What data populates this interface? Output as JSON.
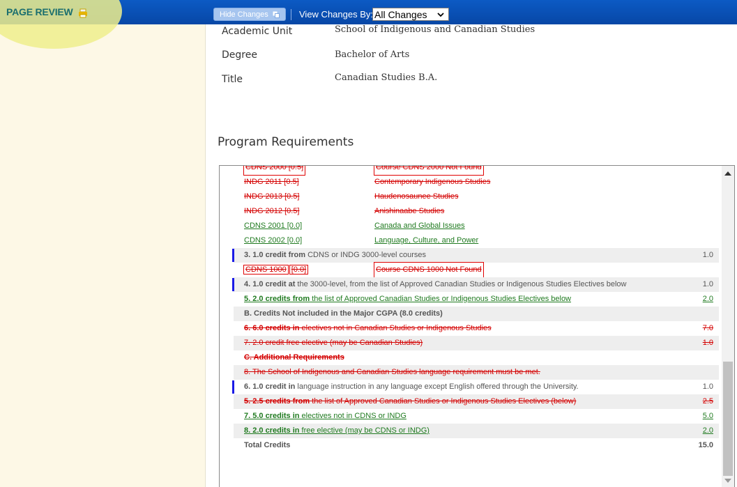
{
  "toolbar": {
    "brand_label": "PAGE REVIEW",
    "hide_changes_label": "Hide Changes",
    "view_changes_label": "View Changes By:",
    "view_changes_value": "All Changes",
    "colors": {
      "bar": "#0747a6",
      "highlight": "#eeee8c",
      "sidebar": "#fdf8e6"
    },
    "icons": [
      "printer-icon",
      "copy-icon",
      "chevron-down-icon"
    ]
  },
  "program": {
    "academic_unit_label": "Academic Unit",
    "academic_unit_value": "School of Indigenous and Canadian Studies",
    "degree_label": "Degree",
    "degree_value": "Bachelor of Arts",
    "title_label": "Title",
    "title_value": "Canadian Studies B.A."
  },
  "requirements": {
    "heading": "Program Requirements",
    "colors": {
      "deleted": "#d40000",
      "inserted": "#1f7a1f",
      "marker": "#1a1ae6",
      "shade": "#eeeeee"
    },
    "r0": {
      "c1": "CDNS 2000 [0.5]",
      "c2": "Course CDNS 2000 Not Found"
    },
    "r1": {
      "c1": "INDG 2011 [0.5]",
      "c2": "Contemporary Indigenous Studies"
    },
    "r2": {
      "c1": "INDG 2013 [0.5]",
      "c2": "Haudenosaunee Studies"
    },
    "r3": {
      "c1": "INDG 2012 [0.5]",
      "c2": "Anishinaabe Studies"
    },
    "r4": {
      "c1": "CDNS 2001 [0.0]",
      "c2": "Canada and Global Issues"
    },
    "r5": {
      "c1": "CDNS 2002 [0.0]",
      "c2": "Language, Culture, and Power"
    },
    "r6": {
      "bold": "3. 1.0 credit from",
      "rest": " CDNS or INDG 3000-level courses",
      "credit": "1.0"
    },
    "r7": {
      "code": "CDNS 1000",
      "credit_tag": "[0.0]",
      "c2": "Course CDNS 1000 Not Found"
    },
    "r8": {
      "bold": "4. 1.0 credit at",
      "rest": " the 3000-level, from the list of Approved Canadian Studies or Indigenous Studies Electives below",
      "credit": "1.0"
    },
    "r9": {
      "bold": "5. 2.0 credits from",
      "rest": " the list of Approved Canadian Studies or Indigenous Studies Electives below",
      "credit": "2.0"
    },
    "r10": {
      "bold": "B. Credits Not included in the Major CGPA (8.0 credits)"
    },
    "r11": {
      "bold": "6. 6.0 credits in",
      "rest": " electives not in Canadian Studies or Indigenous Studies",
      "credit": "7.0"
    },
    "r12": {
      "text": "7. 2.0 credit free elective (may be Canadian Studies)",
      "credit": "1.0"
    },
    "r13": {
      "bold": "C. Additional Requirements"
    },
    "r14": {
      "text": "8. The School of Indigenous and Canadian Studies language requirement must be met."
    },
    "r15": {
      "bold": "6. 1.0 credit in",
      "rest": " language instruction in any language except English offered through the University.",
      "credit": "1.0"
    },
    "r16": {
      "bold": "5. 2.5 credits from",
      "rest": " the list of Approved Canadian Studies or Indigenous Studies Electives (below)",
      "credit": "2.5"
    },
    "r17": {
      "bold": "7. 5.0 credits in",
      "rest": " electives not in CDNS or INDG",
      "credit": "5.0"
    },
    "r18": {
      "bold": "8. 2.0 credits in",
      "rest": " free elective (may be CDNS or INDG)",
      "credit": "2.0"
    },
    "r19": {
      "bold": "Total Credits",
      "credit": "15.0"
    }
  }
}
